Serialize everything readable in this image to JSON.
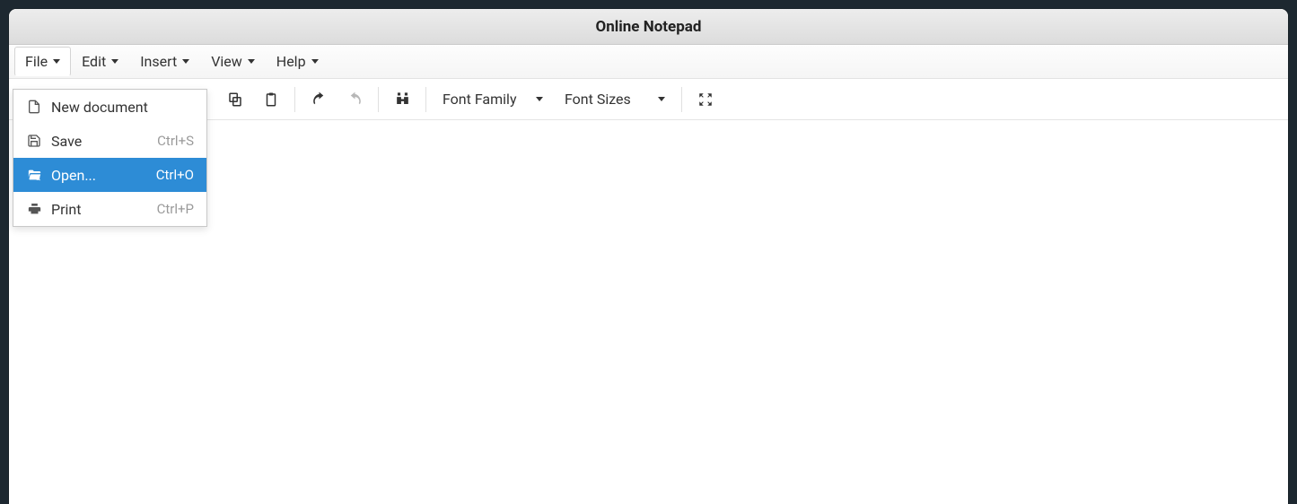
{
  "window": {
    "title": "Online Notepad"
  },
  "menubar": {
    "items": [
      {
        "label": "File"
      },
      {
        "label": "Edit"
      },
      {
        "label": "Insert"
      },
      {
        "label": "View"
      },
      {
        "label": "Help"
      }
    ]
  },
  "toolbar": {
    "font_family_label": "Font Family",
    "font_sizes_label": "Font Sizes"
  },
  "file_menu": {
    "items": [
      {
        "label": "New document",
        "shortcut": ""
      },
      {
        "label": "Save",
        "shortcut": "Ctrl+S"
      },
      {
        "label": "Open...",
        "shortcut": "Ctrl+O"
      },
      {
        "label": "Print",
        "shortcut": "Ctrl+P"
      }
    ]
  }
}
